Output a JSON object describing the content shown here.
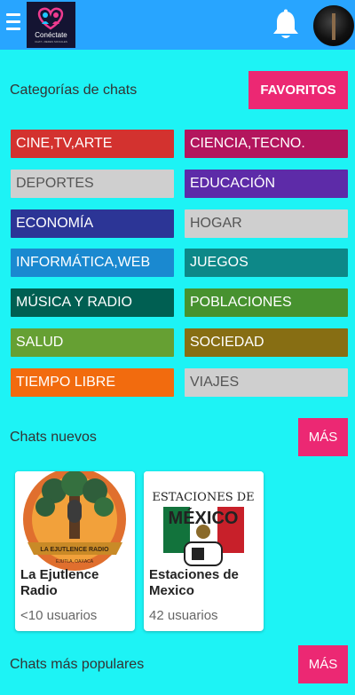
{
  "header": {
    "logo_text": "Conéctate",
    "logo_subtext": "CHAT • REDES SOCIALES"
  },
  "categories_section": {
    "title": "Categorías de chats",
    "favorites_label": "FAVORITOS",
    "items": [
      {
        "label": "CINE,TV,ARTE",
        "color": "#d3322f"
      },
      {
        "label": "CIENCIA,TECNO.",
        "color": "#b3155d"
      },
      {
        "label": "DEPORTES",
        "color": "#cfcfcf"
      },
      {
        "label": "EDUCACIÓN",
        "color": "#5d2ba8"
      },
      {
        "label": "ECONOMÍA",
        "color": "#2c3596"
      },
      {
        "label": "HOGAR",
        "color": "#cfcfcf"
      },
      {
        "label": "INFORMÁTICA,WEB",
        "color": "#1a89d0"
      },
      {
        "label": "JUEGOS",
        "color": "#0d8888"
      },
      {
        "label": "MÚSICA Y RADIO",
        "color": "#005f52"
      },
      {
        "label": "POBLACIONES",
        "color": "#47922f"
      },
      {
        "label": "SALUD",
        "color": "#66a033"
      },
      {
        "label": "SOCIEDAD",
        "color": "#876e13"
      },
      {
        "label": "TIEMPO LIBRE",
        "color": "#f26b0e"
      },
      {
        "label": "VIAJES",
        "color": "#cfcfcf"
      }
    ]
  },
  "new_chats_section": {
    "title": "Chats nuevos",
    "more_label": "MÁS",
    "cards": [
      {
        "title": "La Ejutlence Radio",
        "users": "<10 usuarios",
        "art_banner": "LA EJUTLENCE RADIO",
        "art_caption": "EJUTLA, OAXACA"
      },
      {
        "title": "Estaciones de Mexico",
        "users": "42 usuarios",
        "art_top": "ESTACIONES DE",
        "art_main": "MÉXICO"
      }
    ]
  },
  "popular_section": {
    "title": "Chats más populares",
    "more_label": "MÁS"
  },
  "colors": {
    "background": "#1df3f5",
    "header": "#28a5ff",
    "accent": "#ec2873"
  },
  "icons": {
    "menu": "hamburger-icon",
    "notifications": "bell-icon",
    "profile": "avatar"
  }
}
